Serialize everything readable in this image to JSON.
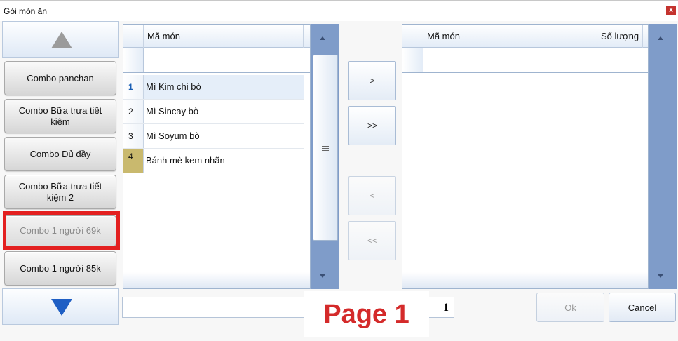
{
  "window": {
    "title": "Gói món ăn",
    "close_glyph": "x"
  },
  "categories": {
    "scroll_up_icon": "triangle-up-gray",
    "scroll_down_icon": "triangle-down-blue",
    "items": [
      {
        "label": "Combo panchan",
        "enabled": true
      },
      {
        "label": "Combo Bữa trưa tiết kiệm",
        "enabled": true
      },
      {
        "label": "Combo Đủ đầy",
        "enabled": true
      },
      {
        "label": "Combo Bữa trưa tiết kiệm 2",
        "enabled": true
      },
      {
        "label": "Combo 1 người 69k",
        "enabled": false,
        "highlighted": true
      },
      {
        "label": "Combo 1 người 85k",
        "enabled": true
      }
    ]
  },
  "source_grid": {
    "column_header": "Mã món",
    "rows": [
      {
        "num": "1",
        "name": "Mì Kim chi bò",
        "selected": true
      },
      {
        "num": "2",
        "name": "Mì Sincay bò"
      },
      {
        "num": "3",
        "name": "Mì Soyum bò"
      },
      {
        "num": "4",
        "name": "Bánh mè kem nhãn"
      }
    ]
  },
  "transfer_buttons": {
    "add_one": ">",
    "add_all": ">>",
    "remove_one": "<",
    "remove_all": "<<"
  },
  "target_grid": {
    "columns": [
      "Mã món",
      "Số lượng"
    ],
    "rows": []
  },
  "pager": {
    "page_number": "1",
    "overlay_label": "Page 1"
  },
  "actions": {
    "ok_label": "Ok",
    "cancel_label": "Cancel"
  },
  "colors": {
    "highlight_frame": "#e32020",
    "overlay_text": "#d42a2a",
    "scrollbar": "#7f9cc9",
    "row_marker": "#c9b96e"
  }
}
